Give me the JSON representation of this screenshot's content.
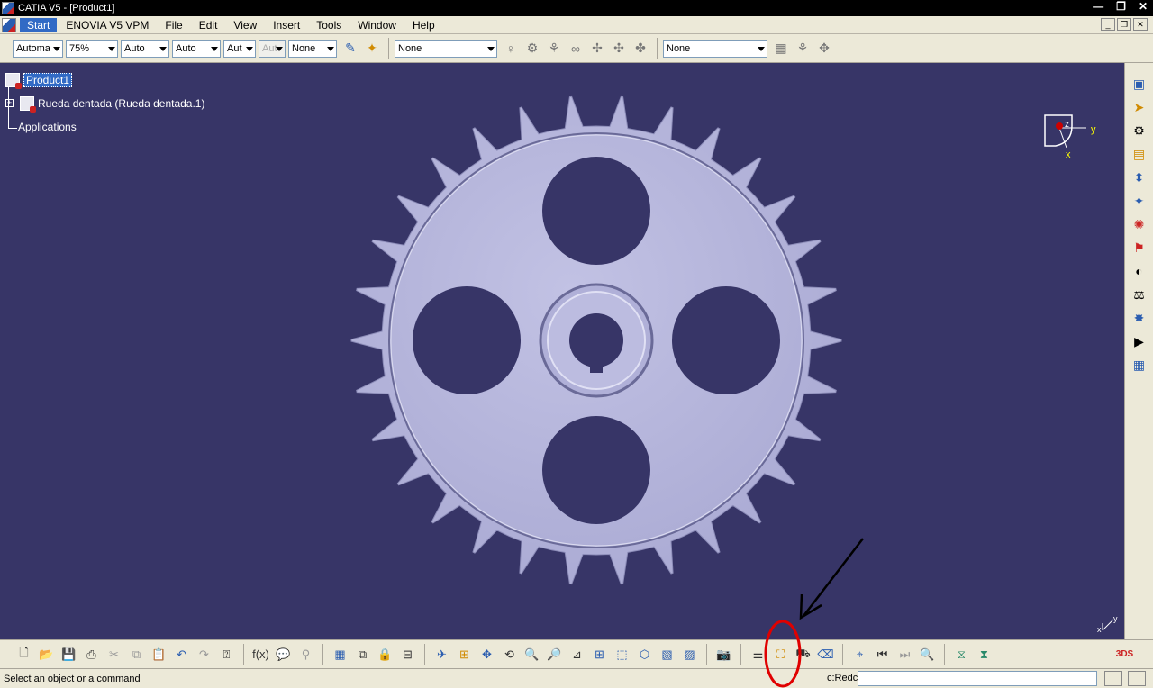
{
  "window": {
    "title": "CATIA V5 - [Product1]",
    "minimize": "—",
    "maximize": "❐",
    "close": "✕"
  },
  "menu": {
    "items": [
      "Start",
      "ENOVIA V5 VPM",
      "File",
      "Edit",
      "View",
      "Insert",
      "Tools",
      "Window",
      "Help"
    ],
    "active_index": 0
  },
  "top_toolbar": {
    "combos": [
      {
        "value": "Automa",
        "width": 56
      },
      {
        "value": "75%",
        "width": 58
      },
      {
        "value": "Auto",
        "width": 54
      },
      {
        "value": "Auto",
        "width": 54
      },
      {
        "value": "Aut",
        "width": 36
      },
      {
        "value": "Aut",
        "width": 30,
        "disabled": true
      },
      {
        "value": "None",
        "width": 54
      }
    ],
    "combo_right_1": "None",
    "combo_right_2": "None"
  },
  "tree": {
    "root": "Product1",
    "child": "Rueda dentada (Rueda dentada.1)",
    "applications": "Applications"
  },
  "compass": {
    "y_label": "y",
    "x_label": "x",
    "z_label": "z"
  },
  "axis_corner": {
    "y": "y",
    "x": "x"
  },
  "status": {
    "message": "Select an object or a command",
    "command_prefix": "c:Redc"
  },
  "colors": {
    "viewport": "#373567",
    "gear": "#b4b4d8",
    "annotation_circle": "#e00000",
    "selection": "#316ac5"
  }
}
